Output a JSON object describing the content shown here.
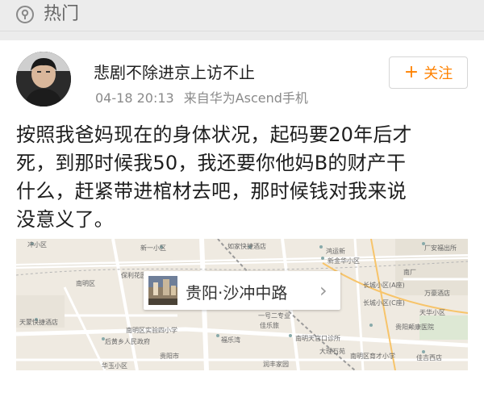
{
  "header": {
    "title": "热门",
    "icon": "location-pin-icon"
  },
  "post": {
    "username": "悲剧不除进京上访不止",
    "timestamp": "04-18 20:13",
    "source": "来自华为Ascend手机",
    "follow_label": "关注",
    "follow_icon": "plus-icon",
    "text_lines": [
      "按照我爸妈现在的身体状况，起码要20年后才",
      "死，到那时候我50，我还要你他妈B的财产干",
      "什么，赶紧带进棺材去吧，那时候钱对我来说",
      "没意义了。"
    ]
  },
  "location": {
    "name": "贵阳·沙冲中路",
    "arrow": "›",
    "map_labels": {
      "chongxiao": "冲小区",
      "xinyi": "新一小区",
      "rujia": "如家快捷酒店",
      "hongyun": "鸿运新",
      "xinjinhua": "新金华小区",
      "nanchang": "南厂",
      "anfu": "厂安福出所",
      "baoli": "保利花园",
      "guiyang_nanming": "南明区",
      "changling": "长城小区(A座)",
      "changling_c": "长城小区(C座)",
      "wanhao": "万豪酒店",
      "tianmeng": "天蒙快捷酒店",
      "nanming_school": "南明区实验四小学",
      "yixiaohu": "一号二专业",
      "jiayuan": "佳乐旅",
      "fulewan": "福乐湾",
      "houqian": "后黄乡人民政府",
      "tianlv": "南明天官口诊所",
      "guiyang_huxi": "贵阳市",
      "huadong": "华玉小区",
      "jianhua": "润丰家园",
      "tongwan": "大理石苑",
      "jinglong": "南明区育才小学",
      "jiazhi": "佳吉西店",
      "qiangxin": "贵阳颠康医院",
      "tianhe": "天华小区",
      "dachang": "大厂"
    }
  },
  "colors": {
    "follow_orange": "#ff8200",
    "map_bg": "#efeae1",
    "road": "#ffffff",
    "railway": "#9a9a9a"
  }
}
